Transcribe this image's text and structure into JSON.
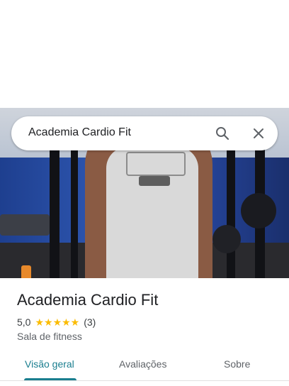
{
  "search": {
    "query": "Academia Cardio Fit"
  },
  "place": {
    "name": "Academia Cardio Fit",
    "rating": "5,0",
    "stars": "★★★★★",
    "review_count": "(3)",
    "category": "Sala de fitness"
  },
  "tabs": [
    {
      "label": "Visão geral",
      "active": true
    },
    {
      "label": "Avaliações",
      "active": false
    },
    {
      "label": "Sobre",
      "active": false
    }
  ],
  "colors": {
    "accent": "#1a7e8f",
    "star": "#fbbc04"
  },
  "icons": {
    "search": "search-icon",
    "close": "close-icon"
  }
}
